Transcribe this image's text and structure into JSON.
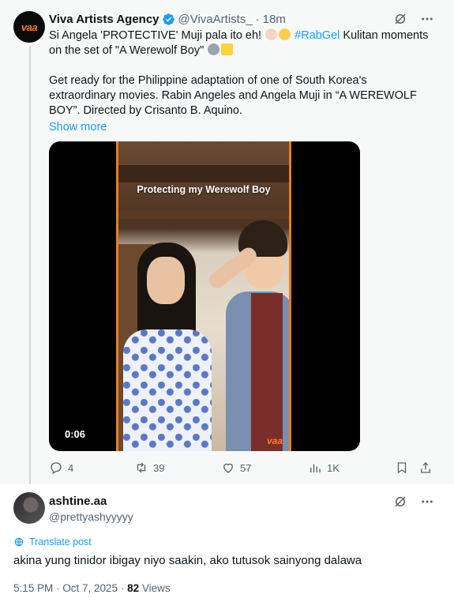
{
  "tweet": {
    "author_name": "Viva Artists Agency",
    "author_handle": "@VivaArtists_",
    "dot": "·",
    "time": "18m",
    "avatar_text": "vaa",
    "line1_start": "Si Angela 'PROTECTIVE' Muji pala ito eh!",
    "hashtag": "#RabGel",
    "line1_end": "Kulitan moments on the set of \"A Werewolf Boy\"",
    "para2": "Get ready for the Philippine adaptation of one of South Korea's extraordinary movies. Rabin Angeles and Angela Muji in “A WEREWOLF BOY”. Directed by Crisanto B. Aquino.",
    "show_more": "Show more",
    "video_caption": "Protecting my Werewolf Boy",
    "video_time": "0:06",
    "watermark": "vaa",
    "stats": {
      "replies": "4",
      "reposts": "39",
      "likes": "57",
      "views": "1K"
    }
  },
  "reply": {
    "name": "ashtine.aa",
    "handle": "@prettyashyyyyy",
    "translate": "Translate post",
    "text": "akina yung tinidor ibigay niyo saakin, ako tutusok sainyong dalawa",
    "timestamp": "5:15 PM · Oct 7, 2025 · ",
    "views_count": "82",
    "views_label": " Views"
  },
  "colors": {
    "accent": "#1d9bf0",
    "muted": "#536471",
    "parent_bg": "#f7f9f9",
    "brand_orange": "#ff7a2f"
  },
  "icons": [
    "verified-badge-icon",
    "grok-icon",
    "more-icon",
    "reply-icon",
    "repost-icon",
    "like-icon",
    "views-icon",
    "bookmark-icon",
    "share-icon",
    "translate-icon"
  ]
}
